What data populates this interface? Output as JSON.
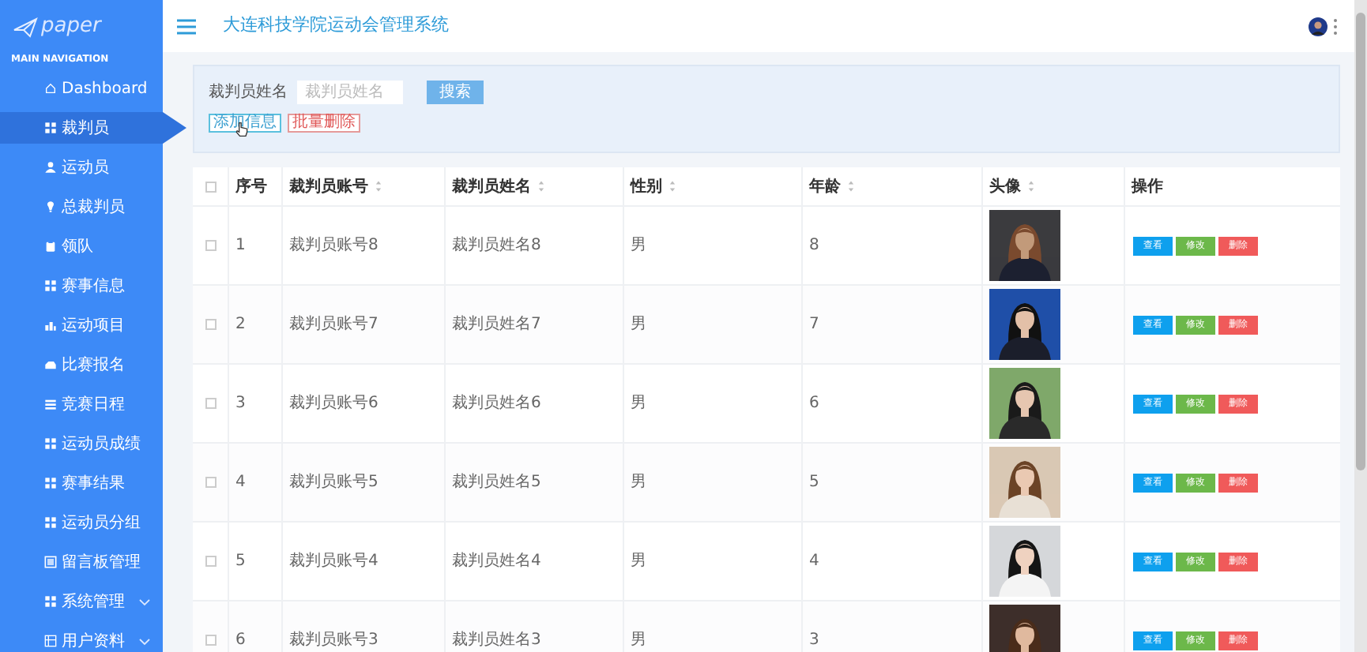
{
  "sidebar": {
    "logo": "paper",
    "section_title": "MAIN NAVIGATION",
    "items": [
      {
        "label": "Dashboard",
        "selected": false
      },
      {
        "label": "裁判员",
        "selected": true
      },
      {
        "label": "运动员",
        "selected": false
      },
      {
        "label": "总裁判员",
        "selected": false
      },
      {
        "label": "领队",
        "selected": false
      },
      {
        "label": "赛事信息",
        "selected": false
      },
      {
        "label": "运动项目",
        "selected": false
      },
      {
        "label": "比赛报名",
        "selected": false
      },
      {
        "label": "竞赛日程",
        "selected": false
      },
      {
        "label": "运动员成绩",
        "selected": false
      },
      {
        "label": "赛事结果",
        "selected": false
      },
      {
        "label": "运动员分组",
        "selected": false
      },
      {
        "label": "留言板管理",
        "selected": false
      },
      {
        "label": "系统管理",
        "selected": false,
        "expanded": false
      },
      {
        "label": "用户资料",
        "selected": false,
        "expanded": false
      }
    ]
  },
  "header": {
    "title": "大连科技学院运动会管理系统"
  },
  "search": {
    "label": "裁判员姓名",
    "placeholder": "裁判员姓名",
    "button": "搜索",
    "actions": [
      {
        "label": "添加信息",
        "kind": "add"
      },
      {
        "label": "批量删除",
        "kind": "delete"
      }
    ]
  },
  "table": {
    "select_all": {
      "checked": false
    },
    "columns": [
      {
        "label": "序号",
        "sortable": false
      },
      {
        "label": "裁判员账号",
        "sortable": true
      },
      {
        "label": "裁判员姓名",
        "sortable": true
      },
      {
        "label": "性别",
        "sortable": true
      },
      {
        "label": "年龄",
        "sortable": true
      },
      {
        "label": "头像",
        "sortable": true
      },
      {
        "label": "操作",
        "sortable": false
      }
    ],
    "rows": [
      {
        "checked": false,
        "index": "1",
        "account": "裁判员账号8",
        "name": "裁判员姓名8",
        "gender": "男",
        "age": "8",
        "actions": [
          {
            "label": "查看",
            "kind": "view"
          },
          {
            "label": "修改",
            "kind": "edit"
          },
          {
            "label": "删除",
            "kind": "delete"
          }
        ]
      },
      {
        "checked": false,
        "index": "2",
        "account": "裁判员账号7",
        "name": "裁判员姓名7",
        "gender": "男",
        "age": "7",
        "actions": [
          {
            "label": "查看",
            "kind": "view"
          },
          {
            "label": "修改",
            "kind": "edit"
          },
          {
            "label": "删除",
            "kind": "delete"
          }
        ]
      },
      {
        "checked": false,
        "index": "3",
        "account": "裁判员账号6",
        "name": "裁判员姓名6",
        "gender": "男",
        "age": "6",
        "actions": [
          {
            "label": "查看",
            "kind": "view"
          },
          {
            "label": "修改",
            "kind": "edit"
          },
          {
            "label": "删除",
            "kind": "delete"
          }
        ]
      },
      {
        "checked": false,
        "index": "4",
        "account": "裁判员账号5",
        "name": "裁判员姓名5",
        "gender": "男",
        "age": "5",
        "actions": [
          {
            "label": "查看",
            "kind": "view"
          },
          {
            "label": "修改",
            "kind": "edit"
          },
          {
            "label": "删除",
            "kind": "delete"
          }
        ]
      },
      {
        "checked": false,
        "index": "5",
        "account": "裁判员账号4",
        "name": "裁判员姓名4",
        "gender": "男",
        "age": "4",
        "actions": [
          {
            "label": "查看",
            "kind": "view"
          },
          {
            "label": "修改",
            "kind": "edit"
          },
          {
            "label": "删除",
            "kind": "delete"
          }
        ]
      },
      {
        "checked": false,
        "index": "6",
        "account": "裁判员账号3",
        "name": "裁判员姓名3",
        "gender": "男",
        "age": "3",
        "actions": [
          {
            "label": "查看",
            "kind": "view"
          },
          {
            "label": "修改",
            "kind": "edit"
          },
          {
            "label": "删除",
            "kind": "delete"
          }
        ]
      }
    ]
  }
}
